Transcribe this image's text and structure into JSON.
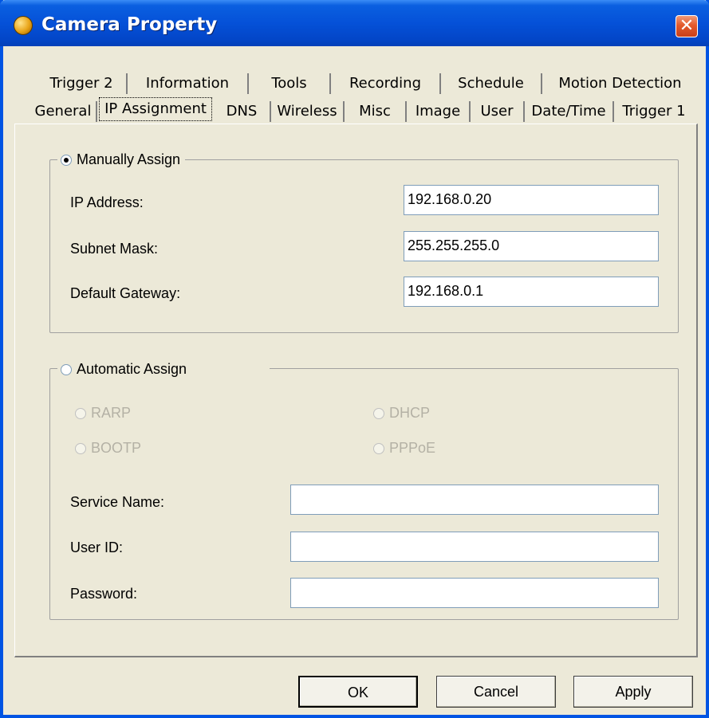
{
  "window": {
    "title": "Camera Property"
  },
  "tabs": {
    "row1": [
      "Trigger 2",
      "Information",
      "Tools",
      "Recording",
      "Schedule",
      "Motion Detection"
    ],
    "row2": [
      "General",
      "IP Assignment",
      "DNS",
      "Wireless",
      "Misc",
      "Image",
      "User",
      "Date/Time",
      "Trigger 1"
    ],
    "selected": "IP Assignment"
  },
  "manual": {
    "label": "Manually Assign",
    "selected": true,
    "ip_label": "IP Address:",
    "ip_value": "192.168.0.20",
    "subnet_label": "Subnet Mask:",
    "subnet_value": "255.255.255.0",
    "gateway_label": "Default Gateway:",
    "gateway_value": "192.168.0.1"
  },
  "automatic": {
    "label": "Automatic Assign",
    "selected": false,
    "rarp": "RARP",
    "dhcp": "DHCP",
    "bootp": "BOOTP",
    "pppoe": "PPPoE",
    "service_label": "Service Name:",
    "service_value": "",
    "userid_label": "User ID:",
    "userid_value": "",
    "password_label": "Password:",
    "password_value": ""
  },
  "buttons": {
    "ok": "OK",
    "cancel": "Cancel",
    "apply": "Apply"
  },
  "colors": {
    "titlebar": "#0551d8",
    "face": "#ece9d8",
    "close": "#e35a2c"
  }
}
